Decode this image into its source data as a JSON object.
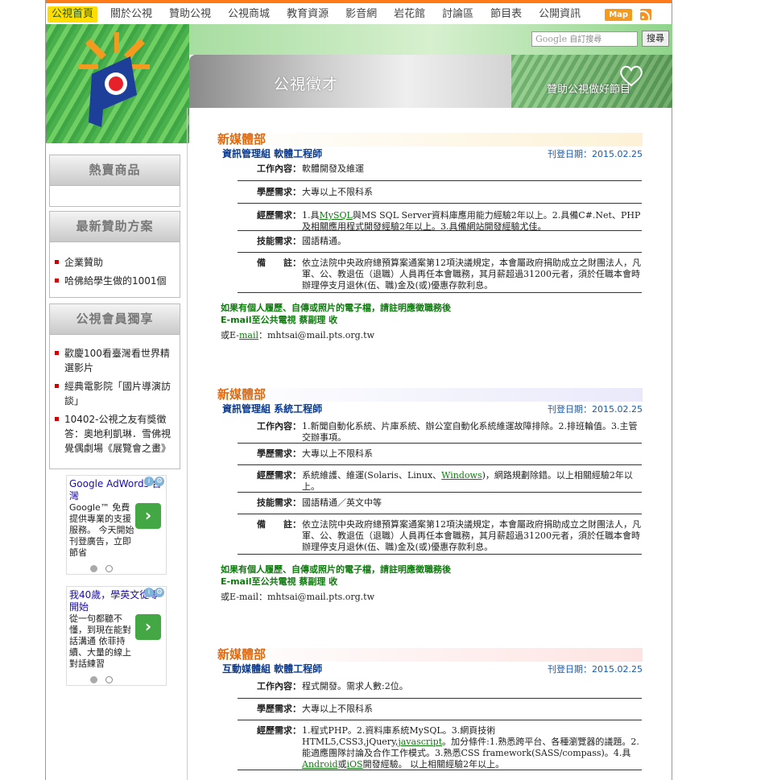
{
  "nav": {
    "items": [
      "公視首頁",
      "關於公視",
      "贊助公視",
      "公視商城",
      "教育資源",
      "影音網",
      "岩花館",
      "討論區",
      "節目表",
      "公開資訊"
    ],
    "map_label": "Map"
  },
  "search": {
    "placeholder": "自訂搜尋",
    "google_label": "Google",
    "button": "搜尋"
  },
  "banner": {
    "title": "公視徵才",
    "subtitle": "贊助公視做好節目"
  },
  "sidebar": {
    "hot": {
      "title": "熱賣商品"
    },
    "sponsor": {
      "title": "最新贊助方案",
      "items": [
        "企業贊助",
        "哈佛給學生做的1001個"
      ]
    },
    "member": {
      "title": "公視會員獨享",
      "items": [
        "歡慶100看臺灣看世界精選影片",
        "經典電影院「國片導演訪談」",
        "10402-公視之友有獎徵答：奧地利凱琳．雪佛視覺偶劇場《展覽會之畫》"
      ]
    }
  },
  "ads": [
    {
      "title": "Google AdWords 台灣",
      "text": "Google™ 免費提供專業的支援服務。 今天開始刊登廣告，立即節省"
    },
    {
      "title": "我40歲，學英文從零開始",
      "text": "從一句都聽不懂，到現在能對話溝通 依菲持續、大量的線上對話練習"
    }
  ],
  "jobs": [
    {
      "dept": "新媒體部",
      "title": "資訊管理組 軟體工程師",
      "date": "刊登日期：2015.02.25",
      "rows": [
        {
          "label": "工作內容：",
          "value": "軟體開發及維運"
        },
        {
          "label": "學歷需求：",
          "value": "大專以上不限科系"
        },
        {
          "label": "經歷需求：",
          "pre": "1.具",
          "link": "MySQL",
          "post": "與MS SQL Server資料庫應用能力經驗2年以上。2.具備C#.Net、PHP及相關應用程式開發經驗2年以上。3.具備網站開發經驗尤佳。"
        },
        {
          "label": "技能需求：",
          "value": "國語精通。"
        },
        {
          "label": "備　　註：",
          "value": "依立法院中央政府總預算案通案第12項決議規定，本會屬政府捐助成立之財團法人，凡軍、公、教退伍（退職）人員再任本會職務，其月薪超過31200元者，須於任職本會時辦理停支月退休(伍、職)金及(或)優惠存款利息。"
        }
      ],
      "note1": "如果有個人履歷、自傳或照片的電子檔，請註明應徵職務後",
      "note2": "E-mail至公共電視 蔡副理 收",
      "mail_pre": "或E-",
      "mail_link": "mail",
      "mail_post": "：mhtsai@mail.pts.org.tw"
    },
    {
      "dept": "新媒體部",
      "title": "資訊管理組 系統工程師",
      "date": "刊登日期：2015.02.25",
      "rows": [
        {
          "label": "工作內容：",
          "value": "1.新聞自動化系統、片庫系統、辦公室自動化系統維運故障排除。2.排班輪值。3.主管交辦事項。"
        },
        {
          "label": "學歷需求：",
          "value": "大專以上不限科系"
        },
        {
          "label": "經歷需求：",
          "pre": "系統維護、維運(Solaris、Linux、",
          "link": "Windows",
          "post": ")，網路規劃除錯。以上相關經驗2年以上。"
        },
        {
          "label": "技能需求：",
          "value": "國語精通／英文中等"
        },
        {
          "label": "備　　註：",
          "value": "依立法院中央政府總預算案通案第12項決議規定，本會屬政府捐助成立之財團法人，凡軍、公、教退伍（退職）人員再任本會職務，其月薪超過31200元者，須於任職本會時辦理停支月退休(伍、職)金及(或)優惠存款利息。"
        }
      ],
      "note1": "如果有個人履歷、自傳或照片的電子檔，請註明應徵職務後",
      "note2": "E-mail至公共電視 蔡副理 收",
      "mail_pre": "或E-mail：mhtsai@mail.pts.org.tw",
      "mail_link": "",
      "mail_post": ""
    },
    {
      "dept": "新媒體部",
      "title": "互動媒體組 軟體工程師",
      "date": "刊登日期：2015.02.25",
      "rows": [
        {
          "label": "工作內容：",
          "value": "程式開發。需求人數:2位。"
        },
        {
          "label": "學歷需求：",
          "value": "大專以上不限科系"
        },
        {
          "label": "經歷需求：",
          "pre": "1.程式PHP。2.資料庫系統MySQL。3.網頁技術HTML5,CSS3,jQuery,",
          "link": "javascript",
          "mid": "。加分條件:1.熟悉跨平台、各種瀏覽器的議題。2.能適應團隊討論及合作工作模式。3.熟悉CSS framework(SASS/compass)。4.具",
          "link2": "Android",
          "mid2": "或",
          "link3": "iOS",
          "post": "開發經驗。 以上相關經驗2年以上。"
        }
      ]
    }
  ],
  "colors": {
    "accent_orange": "#e06a10",
    "title_blue": "#0b3a8c",
    "link_green": "#0e7a0e",
    "nav_orange": "#ff7b19"
  }
}
